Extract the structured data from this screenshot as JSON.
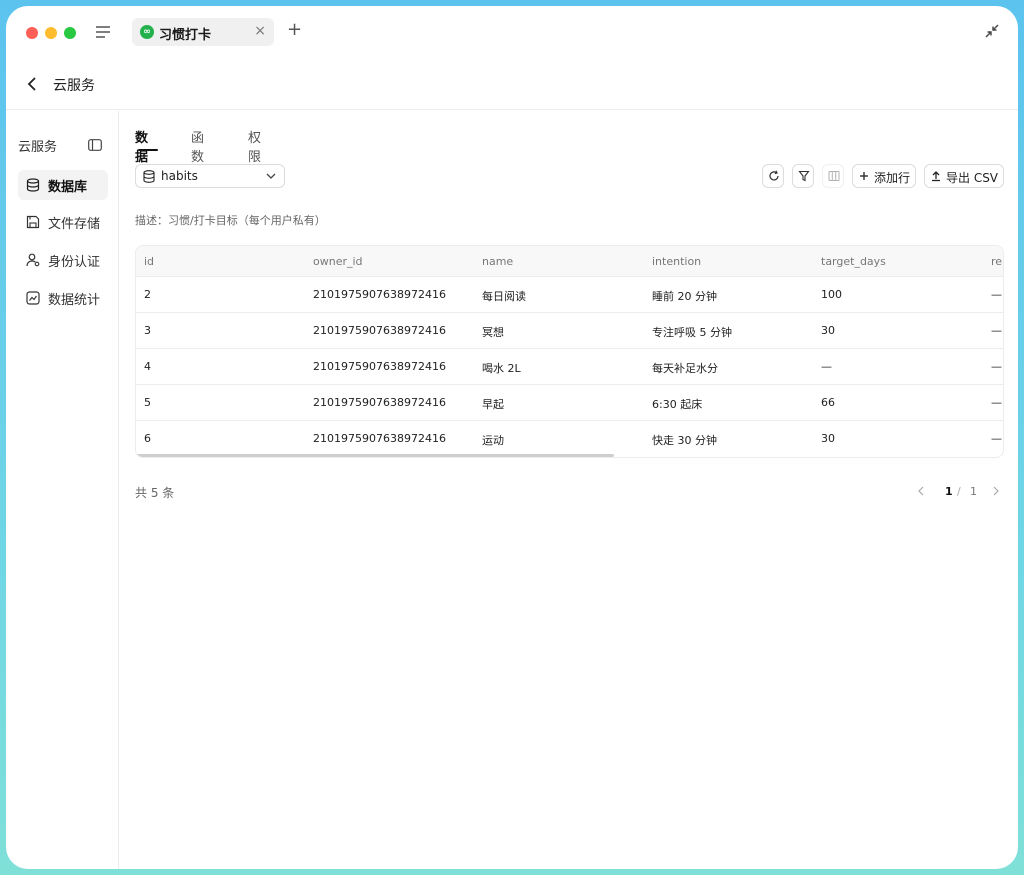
{
  "window": {
    "tab_icon": "link-icon",
    "tab_title": "习惯打卡",
    "tab_close": "×",
    "new_tab": "+"
  },
  "header": {
    "title": "云服务"
  },
  "sidebar": {
    "title": "云服务",
    "items": [
      {
        "label": "数据库",
        "icon": "database-icon",
        "active": true
      },
      {
        "label": "文件存储",
        "icon": "save-icon",
        "active": false
      },
      {
        "label": "身份认证",
        "icon": "user-icon",
        "active": false
      },
      {
        "label": "数据统计",
        "icon": "chart-icon",
        "active": false
      }
    ]
  },
  "main": {
    "tabs": [
      {
        "label": "数据",
        "active": true
      },
      {
        "label": "函数",
        "active": false
      },
      {
        "label": "权限",
        "active": false
      }
    ],
    "table_select": {
      "value": "habits"
    },
    "toolbar": {
      "add_row": "添加行",
      "export_csv": "导出 CSV"
    },
    "description": "描述：习惯/打卡目标（每个用户私有）",
    "table": {
      "columns": [
        "id",
        "owner_id",
        "name",
        "intention",
        "target_days",
        "re"
      ],
      "rows": [
        [
          "2",
          "2101975907638972416",
          "每日阅读",
          "睡前 20 分钟",
          "100",
          "—"
        ],
        [
          "3",
          "2101975907638972416",
          "冥想",
          "专注呼吸 5 分钟",
          "30",
          "—"
        ],
        [
          "4",
          "2101975907638972416",
          "喝水 2L",
          "每天补足水分",
          "—",
          "—"
        ],
        [
          "5",
          "2101975907638972416",
          "早起",
          "6:30 起床",
          "66",
          "—"
        ],
        [
          "6",
          "2101975907638972416",
          "运动",
          "快走 30 分钟",
          "30",
          "—"
        ]
      ]
    },
    "total": "共 5 条",
    "pagination": {
      "current": "1",
      "separator": "/",
      "total": "1"
    }
  },
  "colors": {
    "accent_green": "#22b14c",
    "frame_gradient_top": "#5cc3ee",
    "frame_gradient_bottom": "#7fe0d8"
  }
}
